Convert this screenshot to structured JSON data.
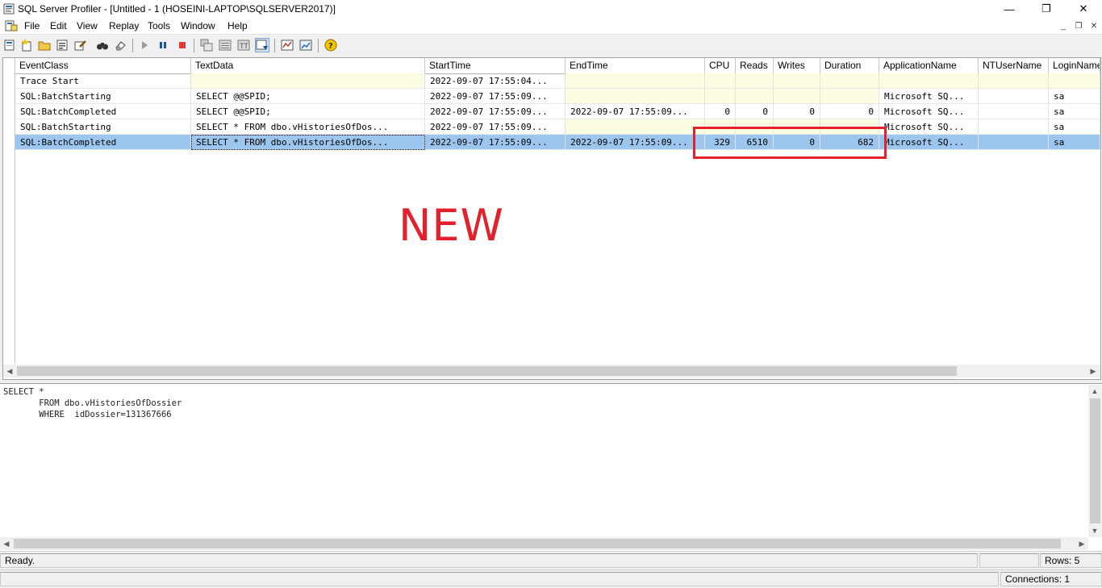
{
  "window": {
    "title": "SQL Server Profiler - [Untitled - 1 (HOSEINI-LAPTOP\\SQLSERVER2017)]",
    "minimize": "—",
    "restore": "❐",
    "close": "✕"
  },
  "menu": {
    "items": [
      "File",
      "Edit",
      "View",
      "Replay",
      "Tools",
      "Window",
      "Help"
    ],
    "mdi_minimize": "_",
    "mdi_restore": "❐",
    "mdi_close": "✕"
  },
  "grid": {
    "columns": [
      "EventClass",
      "TextData",
      "StartTime",
      "EndTime",
      "CPU",
      "Reads",
      "Writes",
      "Duration",
      "ApplicationName",
      "NTUserName",
      "LoginName"
    ],
    "rows": [
      {
        "event": "Trace Start",
        "text": "",
        "start": "2022-09-07 17:55:04...",
        "end": "",
        "cpu": "",
        "reads": "",
        "writes": "",
        "duration": "",
        "app": "",
        "ntuser": "",
        "login": ""
      },
      {
        "event": "SQL:BatchStarting",
        "text": "SELECT @@SPID;",
        "start": "2022-09-07 17:55:09...",
        "end": "",
        "cpu": "",
        "reads": "",
        "writes": "",
        "duration": "",
        "app": "Microsoft SQ...",
        "ntuser": "",
        "login": "sa"
      },
      {
        "event": "SQL:BatchCompleted",
        "text": "SELECT @@SPID;",
        "start": "2022-09-07 17:55:09...",
        "end": "2022-09-07 17:55:09...",
        "cpu": "0",
        "reads": "0",
        "writes": "0",
        "duration": "0",
        "app": "Microsoft SQ...",
        "ntuser": "",
        "login": "sa"
      },
      {
        "event": "SQL:BatchStarting",
        "text": "SELECT *    FROM dbo.vHistoriesOfDos...",
        "start": "2022-09-07 17:55:09...",
        "end": "",
        "cpu": "",
        "reads": "",
        "writes": "",
        "duration": "",
        "app": "Microsoft SQ...",
        "ntuser": "",
        "login": "sa"
      },
      {
        "event": "SQL:BatchCompleted",
        "text": "SELECT *    FROM dbo.vHistoriesOfDos...",
        "start": "2022-09-07 17:55:09...",
        "end": "2022-09-07 17:55:09...",
        "cpu": "329",
        "reads": "6510",
        "writes": "0",
        "duration": "682",
        "app": "Microsoft SQ...",
        "ntuser": "",
        "login": "sa"
      }
    ]
  },
  "annotation": {
    "label": "NEW",
    "color": "#e3212d"
  },
  "text_panel": {
    "sql": "SELECT *\n       FROM dbo.vHistoriesOfDossier\n       WHERE  idDossier=131367666"
  },
  "status": {
    "ready": "Ready.",
    "rows": "Rows: 5",
    "connections": "Connections: 1"
  },
  "colors": {
    "selection": "#9dc6ee",
    "yellow_cell": "#fcfce0",
    "highlight": "#e3212d"
  }
}
